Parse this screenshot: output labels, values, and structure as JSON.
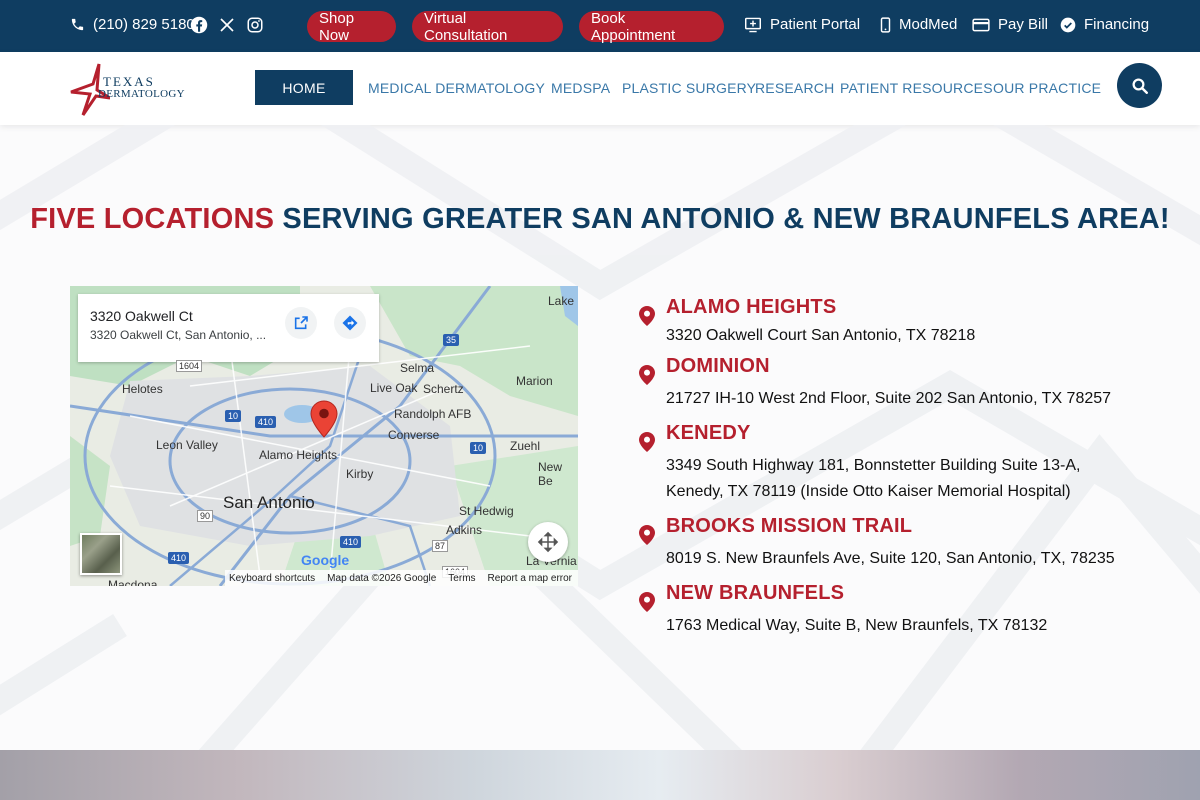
{
  "topbar": {
    "phone": "(210) 829 5180",
    "buttons": [
      "Shop Now",
      "Virtual Consultation",
      "Book Appointment"
    ],
    "links": [
      "Patient Portal",
      "ModMed",
      "Pay Bill",
      "Financing"
    ]
  },
  "logo": {
    "line1": "TEXAS",
    "line2": "DERMATOLOGY"
  },
  "nav": {
    "home": "HOME",
    "items": [
      "MEDICAL DERMATOLOGY",
      "MEDSPA",
      "PLASTIC SURGERY",
      "RESEARCH",
      "PATIENT RESOURCES",
      "OUR PRACTICE"
    ]
  },
  "heading": {
    "red": "FIVE LOCATIONS",
    "blue": "SERVING GREATER SAN ANTONIO & NEW BRAUNFELS AREA!"
  },
  "map": {
    "card_title": "3320 Oakwell Ct",
    "card_subtitle": "3320 Oakwell Ct, San Antonio, ...",
    "labels": [
      "Lake",
      "Selma",
      "Marion",
      "Helotes",
      "Live Oak",
      "Schertz",
      "Randolph AFB",
      "Leon Valley",
      "Converse",
      "Zuehl",
      "Alamo Heights",
      "Kirby",
      "New Be",
      "San Antonio",
      "St Hedwig",
      "Adkins",
      "La Vernia",
      "Macdona"
    ],
    "highways": [
      "1604",
      "35",
      "10",
      "410",
      "10",
      "90",
      "410",
      "87",
      "410",
      "1604"
    ],
    "footer": [
      "Keyboard shortcuts",
      "Map data ©2026 Google",
      "Terms",
      "Report a map error"
    ],
    "google": "Google"
  },
  "locations": [
    {
      "name": "ALAMO HEIGHTS",
      "address": "3320 Oakwell Court San Antonio, TX 78218"
    },
    {
      "name": "DOMINION",
      "address": "21727 IH-10 West 2nd Floor, Suite 202 San Antonio, TX 78257"
    },
    {
      "name": "KENEDY",
      "address": "3349 South Highway 181, Bonnstetter Building Suite 13-A, Kenedy, TX 78119 (Inside Otto Kaiser Memorial Hospital)"
    },
    {
      "name": "BROOKS MISSION TRAIL",
      "address": "8019 S. New Braunfels Ave, Suite 120, San Antonio, TX, 78235"
    },
    {
      "name": "NEW BRAUNFELS",
      "address": "1763 Medical Way, Suite B, New Braunfels, TX 78132"
    }
  ],
  "colors": {
    "navy": "#0f3d61",
    "red": "#b5202e",
    "navlink": "#3a78a8"
  }
}
